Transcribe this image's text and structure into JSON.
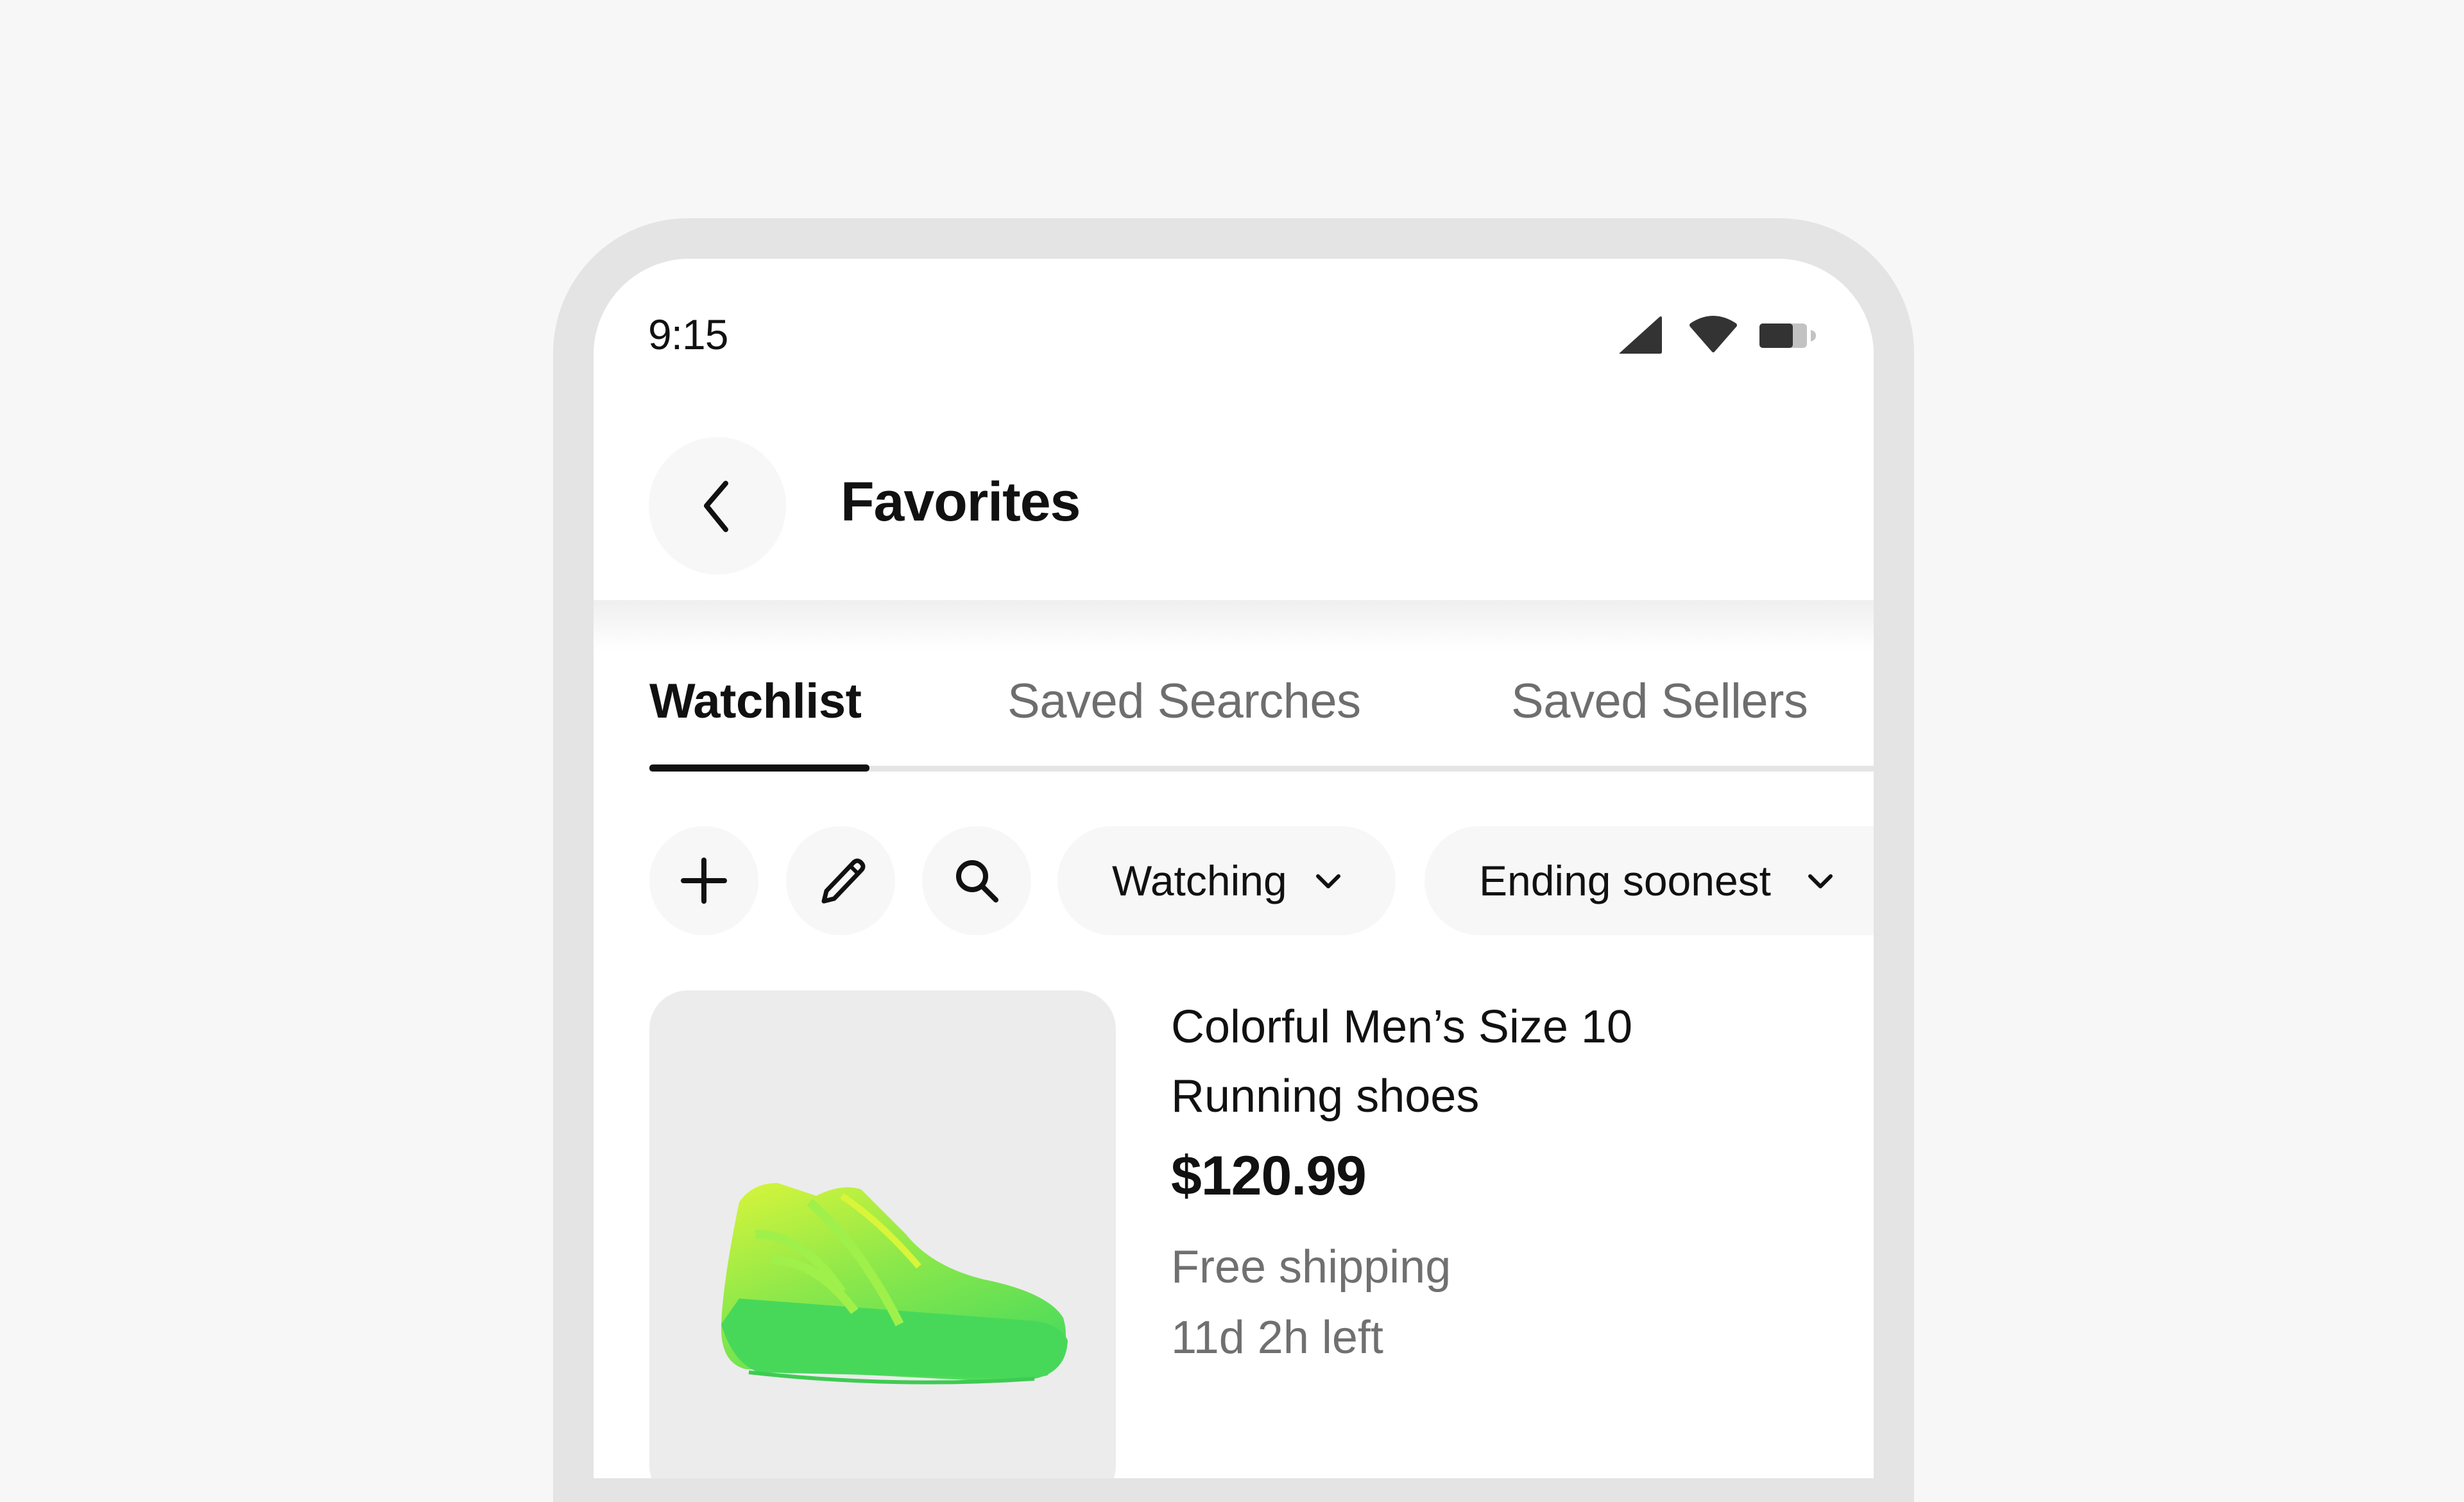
{
  "status_bar": {
    "time": "9:15",
    "icons": [
      "cellular-signal-icon",
      "wifi-icon",
      "battery-icon"
    ]
  },
  "header": {
    "back_icon": "chevron-left-icon",
    "title": "Favorites"
  },
  "tabs": [
    {
      "label": "Watchlist",
      "active": true
    },
    {
      "label": "Saved Searches",
      "active": false
    },
    {
      "label": "Saved Sellers",
      "active": false
    }
  ],
  "toolbar": {
    "icon_buttons": [
      {
        "name": "add-button",
        "icon": "plus-icon"
      },
      {
        "name": "edit-button",
        "icon": "pencil-icon"
      },
      {
        "name": "search-button",
        "icon": "search-icon"
      }
    ],
    "filter_chip": {
      "label": "Watching",
      "icon": "chevron-down-icon"
    },
    "sort_chip": {
      "label": "Ending soonest",
      "icon": "chevron-down-icon"
    }
  },
  "items": [
    {
      "image": "green-basketball-sneaker",
      "title": "Colorful Men’s Size 10 Running shoes",
      "price": "$120.99",
      "shipping": "Free shipping",
      "time_left": "11d 2h left"
    }
  ],
  "colors": {
    "background": "#f7f7f7",
    "frame": "#e4e4e4",
    "text_primary": "#111111",
    "text_secondary": "#707070",
    "chip_bg": "#f7f7f7",
    "tab_rule": "#e5e5e5"
  }
}
